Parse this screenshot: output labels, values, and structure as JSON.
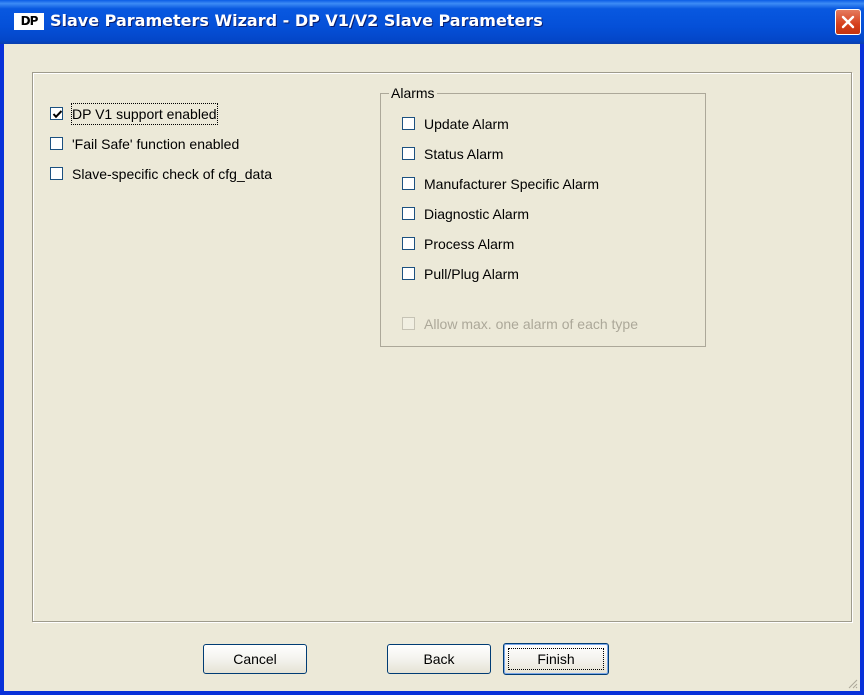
{
  "window": {
    "icon_text": "DP",
    "title": "Slave Parameters Wizard - DP V1/V2 Slave Parameters"
  },
  "options": [
    {
      "label": "DP V1 support enabled",
      "checked": true,
      "enabled": true
    },
    {
      "label": "'Fail Safe' function enabled",
      "checked": false,
      "enabled": true
    },
    {
      "label": "Slave-specific check of cfg_data",
      "checked": false,
      "enabled": true
    }
  ],
  "alarms": {
    "title": "Alarms",
    "items": [
      {
        "label": "Update Alarm",
        "checked": false,
        "enabled": true
      },
      {
        "label": "Status Alarm",
        "checked": false,
        "enabled": true
      },
      {
        "label": "Manufacturer Specific Alarm",
        "checked": false,
        "enabled": true
      },
      {
        "label": "Diagnostic Alarm",
        "checked": false,
        "enabled": true
      },
      {
        "label": "Process Alarm",
        "checked": false,
        "enabled": true
      },
      {
        "label": "Pull/Plug Alarm",
        "checked": false,
        "enabled": true
      }
    ],
    "allow_max": {
      "label": "Allow max. one alarm of each type",
      "checked": false,
      "enabled": false
    }
  },
  "buttons": {
    "cancel": "Cancel",
    "back": "Back",
    "finish": "Finish"
  },
  "colors": {
    "titlebar": "#0550d8",
    "dialog_bg": "#ece9d8",
    "close_button": "#d6401d",
    "checkbox_border": "#1c5180",
    "disabled_text": "#aca899"
  }
}
